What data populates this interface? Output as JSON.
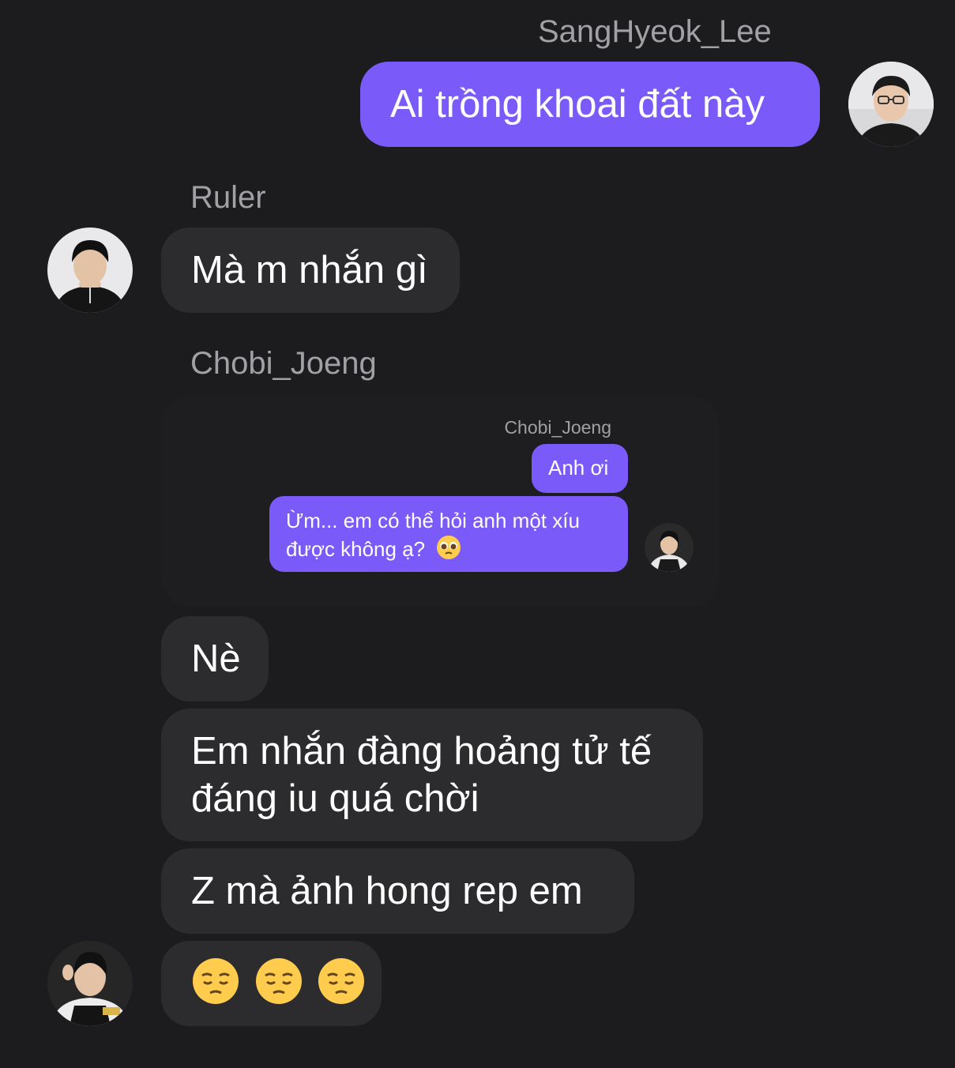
{
  "chat": {
    "messages": [
      {
        "sender": "SangHyeok_Lee",
        "text": "Ai trồng khoai đất này",
        "direction": "outgoing"
      },
      {
        "sender": "Ruler",
        "text": "Mà m nhắn gì",
        "direction": "incoming"
      },
      {
        "sender": "Chobi_Joeng",
        "type": "forwarded-screenshot"
      },
      {
        "text": "Nè",
        "direction": "incoming"
      },
      {
        "text_line1": "Em nhắn đàng hoảng tử tế",
        "text_line2": "đáng iu quá chời",
        "direction": "incoming"
      },
      {
        "text": "Z mà ảnh hong rep em",
        "direction": "incoming"
      },
      {
        "emojis": [
          "pensive-face",
          "pensive-face",
          "pensive-face"
        ],
        "direction": "incoming"
      }
    ]
  },
  "forwarded": {
    "sender": "Chobi_Joeng",
    "msg1": "Anh ơi",
    "msg2_line1": "Ừm... em có thể hỏi anh một xíu",
    "msg2_line2": "được không ạ?",
    "msg2_emoji": "pleading-face"
  },
  "colors": {
    "background": "#1c1c1e",
    "incoming_bubble": "#2c2c2e",
    "outgoing_bubble": "#7a5af8",
    "sender_name": "#a0a0a5"
  }
}
